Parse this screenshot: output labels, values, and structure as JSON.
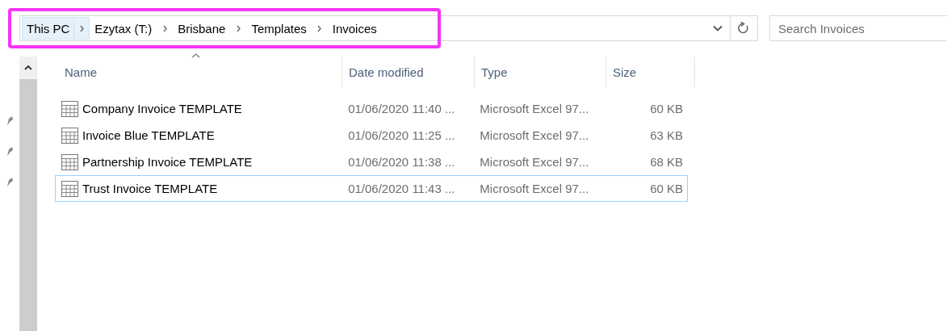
{
  "address_bar": {
    "breadcrumbs": [
      {
        "label": "This PC",
        "highlighted": true
      },
      {
        "label": "Ezytax (T:)",
        "highlighted": false
      },
      {
        "label": "Brisbane",
        "highlighted": false
      },
      {
        "label": "Templates",
        "highlighted": false
      },
      {
        "label": "Invoices",
        "highlighted": false
      }
    ],
    "annotation_highlight": true
  },
  "search": {
    "placeholder": "Search Invoices"
  },
  "sidebar": {
    "pinned_items": [
      {
        "pinned": true
      },
      {
        "pinned": true
      },
      {
        "pinned": true
      }
    ]
  },
  "file_list": {
    "columns": [
      {
        "label": "Name",
        "sorted": true
      },
      {
        "label": "Date modified",
        "sorted": false
      },
      {
        "label": "Type",
        "sorted": false
      },
      {
        "label": "Size",
        "sorted": false
      }
    ],
    "rows": [
      {
        "name": "Company Invoice TEMPLATE",
        "date_modified": "01/06/2020 11:40 ...",
        "type": "Microsoft Excel 97...",
        "size": "60 KB",
        "focused": false
      },
      {
        "name": "Invoice Blue TEMPLATE",
        "date_modified": "01/06/2020 11:25 ...",
        "type": "Microsoft Excel 97...",
        "size": "63 KB",
        "focused": false
      },
      {
        "name": "Partnership Invoice TEMPLATE",
        "date_modified": "01/06/2020 11:38 ...",
        "type": "Microsoft Excel 97...",
        "size": "68 KB",
        "focused": false
      },
      {
        "name": "Trust Invoice TEMPLATE",
        "date_modified": "01/06/2020 11:43 ...",
        "type": "Microsoft Excel 97...",
        "size": "60 KB",
        "focused": true
      }
    ]
  }
}
